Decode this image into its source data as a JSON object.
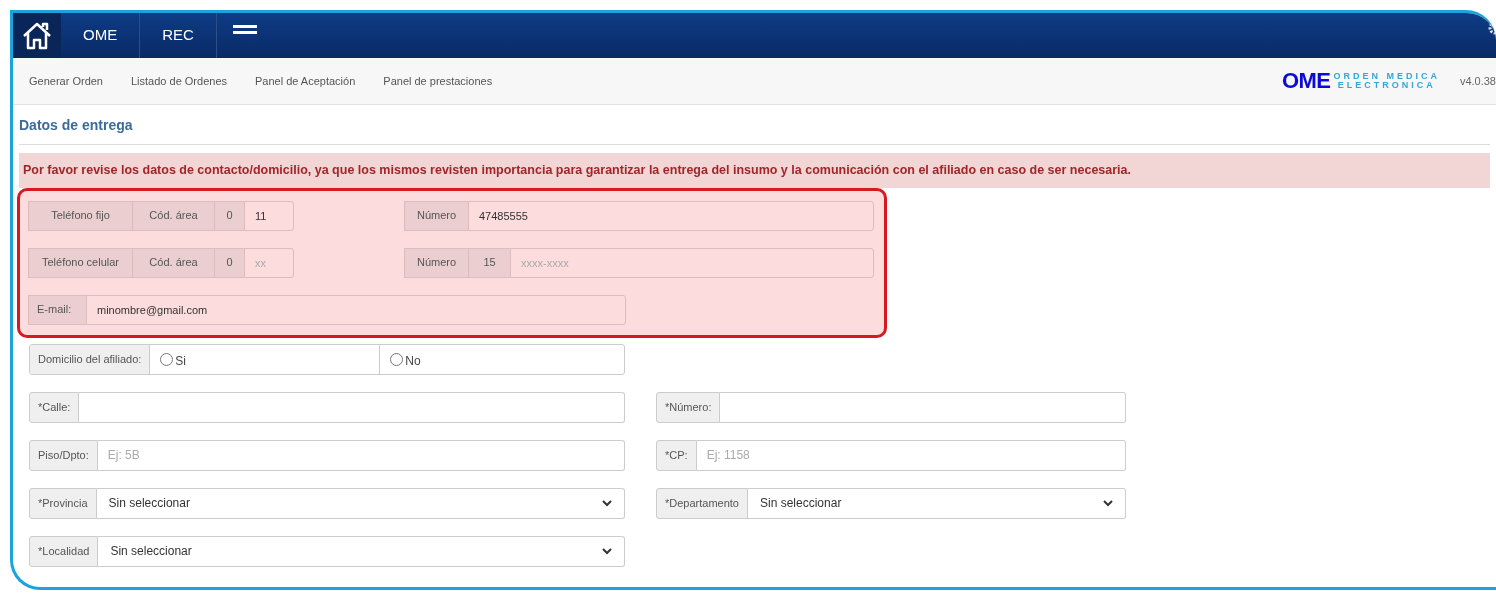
{
  "header": {
    "tabs": [
      {
        "label": "OME"
      },
      {
        "label": "REC"
      }
    ]
  },
  "subnav": {
    "items": [
      "Generar Orden",
      "Listado de Ordenes",
      "Panel de Aceptación",
      "Panel de prestaciones"
    ],
    "logo": {
      "mark": "OME",
      "line1": "ORDEN MEDICA",
      "line2": "ELECTRONICA"
    },
    "version": "v4.0.38"
  },
  "section_title": "Datos de entrega",
  "alert": "Por favor revise los datos de contacto/domicilio, ya que los mismos revisten importancia para garantizar la entrega del insumo y la comunicación con el afiliado en caso de ser necesaria.",
  "phones": [
    {
      "label": "Teléfono fijo",
      "area_label": "Cód. área",
      "area_prefix": "0",
      "area_value": "11",
      "number_label": "Número",
      "number_value": "47485555"
    },
    {
      "label": "Teléfono celular",
      "area_label": "Cód. área",
      "area_prefix": "0",
      "area_placeholder": "xx",
      "number_label": "Número",
      "number_prefix": "15",
      "number_placeholder": "xxxx-xxxx"
    }
  ],
  "email": {
    "label": "E-mail:",
    "value": "minombre@gmail.com"
  },
  "domicilio": {
    "label": "Domicilio del afiliado:",
    "options": [
      {
        "label": "Si",
        "selected": false
      },
      {
        "label": "No",
        "selected": false
      }
    ]
  },
  "address_rows": [
    [
      {
        "kind": "text",
        "label": "*Calle:"
      },
      {
        "kind": "text",
        "label": "*Número:"
      }
    ],
    [
      {
        "kind": "text",
        "label": "Piso/Dpto:",
        "placeholder": "Ej: 5B"
      },
      {
        "kind": "text",
        "label": "*CP:",
        "placeholder": "Ej: 1158"
      }
    ],
    [
      {
        "kind": "select",
        "label": "*Provincia",
        "value": "Sin seleccionar"
      },
      {
        "kind": "select",
        "label": "*Departamento",
        "value": "Sin seleccionar"
      }
    ],
    [
      {
        "kind": "select",
        "label": "*Localidad",
        "value": "Sin seleccionar"
      }
    ]
  ]
}
